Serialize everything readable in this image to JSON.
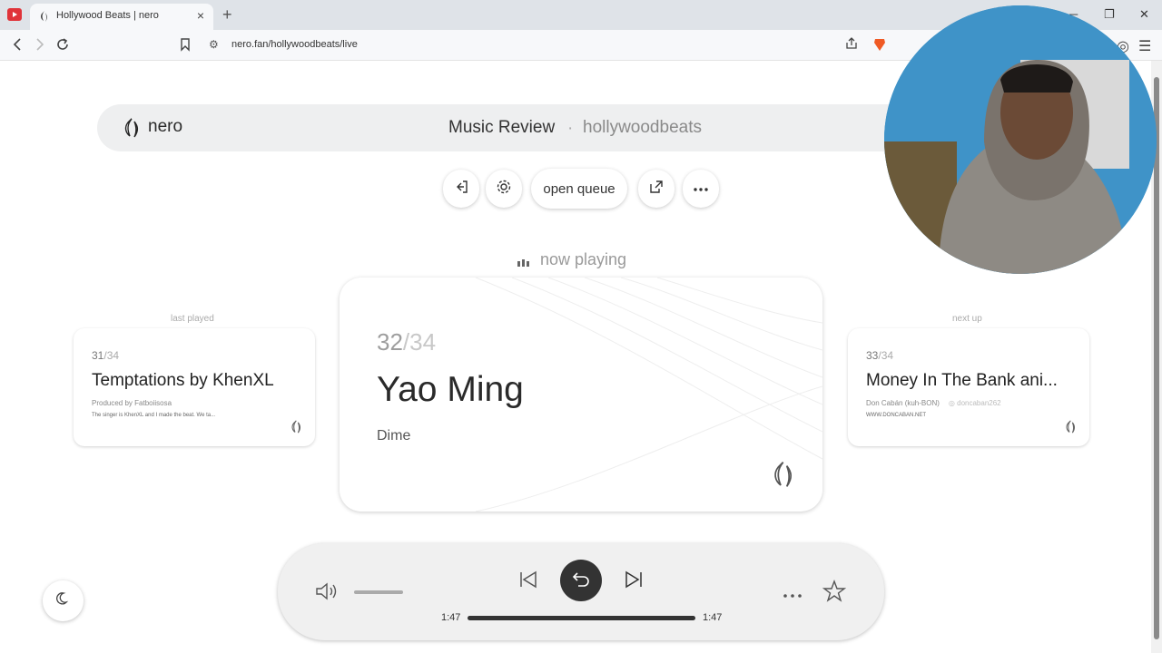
{
  "browser": {
    "tab_title": "Hollywood Beats | nero",
    "url": "nero.fan/hollywoodbeats/live",
    "new_tab": "+",
    "tab_close": "×"
  },
  "header": {
    "logo_text": "nero",
    "title": "Music Review",
    "separator": "·",
    "subtitle": "hollywoodbeats"
  },
  "toolbar": {
    "open_queue": "open queue"
  },
  "now_playing_label": "now playing",
  "last_played": {
    "label": "last played",
    "index": "31",
    "total": "/34",
    "title": "Temptations by KhenXL",
    "meta": "Produced by Fatboiisosa",
    "meta2": "The singer is KhenXL and I made the beat. We ta..."
  },
  "current": {
    "index": "32",
    "total": "/34",
    "title": "Yao Ming",
    "artist": "Dime"
  },
  "next_up": {
    "label": "next up",
    "index": "33",
    "total": "/34",
    "title": "Money In The Bank ani...",
    "meta": "Don Cabán (kuh-BON)",
    "meta_handle": "doncaban262",
    "meta2": "WWW.DONCABAN.NET"
  },
  "player": {
    "time_current": "1:47",
    "time_total": "1:47",
    "progress": 1.0,
    "volume": 0.75
  },
  "colors": {
    "accent_dark": "#333333",
    "card_bg": "#ffffff",
    "header_bg": "#eeeff0",
    "player_bg": "#f0f0f0",
    "brand_red": "#e0343a"
  }
}
